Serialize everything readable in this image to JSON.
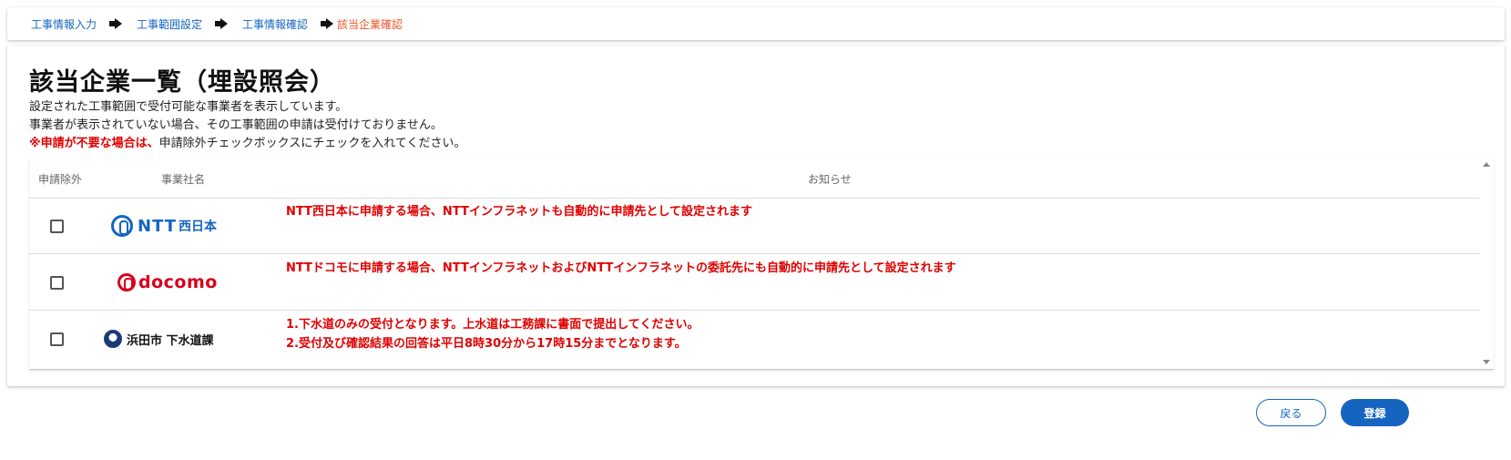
{
  "breadcrumb": {
    "steps": [
      "工事情報入力",
      "工事範囲設定",
      "工事情報確認"
    ],
    "current": "該当企業確認"
  },
  "page": {
    "title": "該当企業一覧（埋設照会）",
    "desc_line1": "設定された工事範囲で受付可能な事業者を表示しています。",
    "desc_line2": "事業者が表示されていない場合、その工事範囲の申請は受付けておりません。",
    "desc_warn": "※申請が不要な場合は、",
    "desc_warn_rest": "申請除外チェックボックスにチェックを入れてください。"
  },
  "table": {
    "headers": {
      "exclude": "申請除外",
      "company": "事業社名",
      "notice": "お知らせ"
    },
    "rows": [
      {
        "company_text": "NTT",
        "company_sub": "西日本",
        "checked": false,
        "notices": [
          "NTT西日本に申請する場合、NTTインフラネットも自動的に申請先として設定されます"
        ]
      },
      {
        "company_text": "docomo",
        "checked": false,
        "notices": [
          "NTTドコモに申請する場合、NTTインフラネットおよびNTTインフラネットの委託先にも自動的に申請先として設定されます"
        ]
      },
      {
        "company_text": "浜田市 下水道課",
        "checked": false,
        "notices": [
          "1.下水道のみの受付となります。上水道は工務課に書面で提出してください。",
          "2.受付及び確認結果の回答は平日8時30分から17時15分までとなります。"
        ]
      }
    ]
  },
  "buttons": {
    "back": "戻る",
    "submit": "登録"
  },
  "colors": {
    "primary": "#1565c0",
    "warning": "#e00000",
    "current_step": "#e8542a"
  }
}
